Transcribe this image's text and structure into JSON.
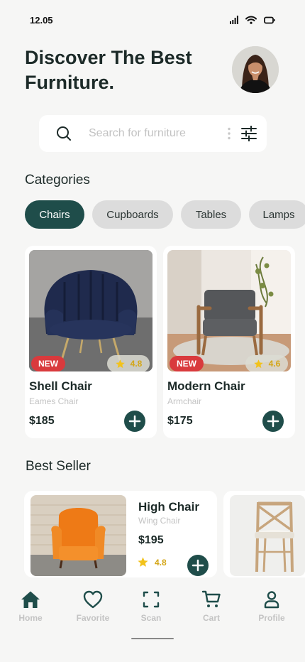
{
  "status": {
    "time": "12.05"
  },
  "header": {
    "title_line1": "Discover The Best",
    "title_line2": "Furniture."
  },
  "search": {
    "placeholder": "Search for furniture"
  },
  "categories": {
    "title": "Categories",
    "items": [
      {
        "label": "Chairs",
        "active": true
      },
      {
        "label": "Cupboards",
        "active": false
      },
      {
        "label": "Tables",
        "active": false
      },
      {
        "label": "Lamps",
        "active": false
      }
    ]
  },
  "products": [
    {
      "badge": "NEW",
      "rating": "4.8",
      "name": "Shell Chair",
      "subtitle": "Eames Chair",
      "price": "$185",
      "image_icon": "navy-shell-chair"
    },
    {
      "badge": "NEW",
      "rating": "4.6",
      "name": "Modern Chair",
      "subtitle": "Armchair",
      "price": "$175",
      "image_icon": "grey-wood-armchair"
    }
  ],
  "best_seller": {
    "title": "Best Seller",
    "items": [
      {
        "name": "High Chair",
        "subtitle": "Wing Chair",
        "price": "$195",
        "rating": "4.8",
        "image_icon": "orange-wing-chair"
      },
      {
        "image_icon": "wooden-cross-back-chair"
      }
    ]
  },
  "bottom_nav": [
    {
      "label": "Home",
      "icon": "home-icon",
      "active": true
    },
    {
      "label": "Favorite",
      "icon": "heart-icon",
      "active": false
    },
    {
      "label": "Scan",
      "icon": "scan-icon",
      "active": false
    },
    {
      "label": "Cart",
      "icon": "cart-icon",
      "active": false
    },
    {
      "label": "Profile",
      "icon": "profile-icon",
      "active": false
    }
  ],
  "colors": {
    "accent": "#1f4d4a",
    "badge": "#d93a3d",
    "star": "#f2c21b",
    "background": "#f6f6f5"
  }
}
